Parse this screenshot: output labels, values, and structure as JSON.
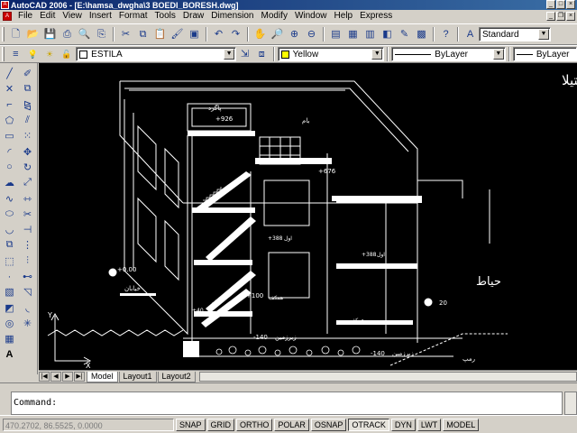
{
  "window": {
    "title": "AutoCAD 2006 - [E:\\hamsa_dwgha\\3 BOEDI_BORESH.dwg]"
  },
  "menu": [
    "File",
    "Edit",
    "View",
    "Insert",
    "Format",
    "Tools",
    "Draw",
    "Dimension",
    "Modify",
    "Window",
    "Help",
    "Express"
  ],
  "toolbar": {
    "text_style": "Standard"
  },
  "layers": {
    "current_layer": "ESTILA",
    "color": "Yellow",
    "color_hex": "#ffff00",
    "linetype": "ByLayer",
    "lineweight": "ByLayer"
  },
  "drawing": {
    "title_arabic": "طرح وترسيم :استيلا",
    "label_hayat": "حياط",
    "level_926": "+926",
    "level_676": "+676",
    "level_388a": "+388",
    "level_388b": "+388",
    "level_100": "+100",
    "level_40": "+40",
    "level_0": "+0.00",
    "level_m140a": "-140",
    "level_m140b": "-140",
    "level_20": "20",
    "lbl_roof": "بام",
    "lbl_stair": "پاگرد",
    "lbl_first_a": "اول",
    "lbl_first_b": "اول",
    "lbl_ground_a": "همکف",
    "lbl_ground_b": "همکف",
    "lbl_basement_a": "زیرزمین",
    "lbl_basement_b": "زیرزمین",
    "lbl_street": "خیابان",
    "lbl_ramp": "رمپ"
  },
  "tabs": [
    "Model",
    "Layout1",
    "Layout2"
  ],
  "command": {
    "prompt": "Command:"
  },
  "status": {
    "coords": "470.2702, 86.5525, 0.0000",
    "buttons": [
      "SNAP",
      "GRID",
      "ORTHO",
      "POLAR",
      "OSNAP",
      "OTRACK",
      "DYN",
      "LWT",
      "MODEL"
    ]
  }
}
